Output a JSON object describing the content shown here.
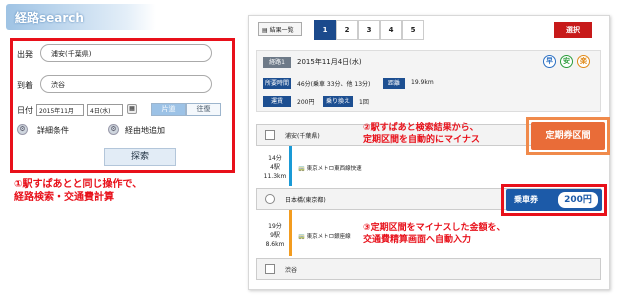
{
  "header": {
    "title": "経路search"
  },
  "form": {
    "departure_label": "出発",
    "departure_value": "浦安(千葉県)",
    "arrival_label": "到着",
    "arrival_value": "渋谷",
    "date_label": "日付",
    "year_month": "2015年11月",
    "day": "4日(水)",
    "oneway_label": "片道",
    "roundtrip_label": "往復",
    "detail_label": "詳細条件",
    "via_label": "経由地追加",
    "search_label": "探索"
  },
  "notes": {
    "note1_line1": "①駅すぱあとと同じ操作で、",
    "note1_line2": "経路検索・交通費計算",
    "note2_line1": "②駅すぱあと検索結果から、",
    "note2_line2": "定期区間を自動的にマイナス",
    "note3_line1": "③定期区間をマイナスした金額を、",
    "note3_line2": "交通費精算画面へ自動入力"
  },
  "results": {
    "list_label": "結果一覧",
    "tabs": [
      "1",
      "2",
      "3",
      "4",
      "5"
    ],
    "select_label": "選択",
    "route_tag": "経路1",
    "route_date": "2015年11月4日(水)",
    "badges": [
      "早",
      "安",
      "楽"
    ],
    "time_tag": "所要時間",
    "time_value": "46分(乗車 33分、他 13分)",
    "dist_tag": "距離",
    "dist_value": "19.9km",
    "fare_tag": "運賃",
    "fare_value": "200円",
    "transfer_tag": "乗り換え",
    "transfer_value": "1回",
    "stations": [
      "浦安(千葉県)",
      "日本橋(東京都)",
      "渋谷"
    ],
    "seg1": {
      "time": "14分",
      "stops": "4駅",
      "dist": "11.3km",
      "line": "東京メトロ東西線快速"
    },
    "seg2": {
      "time": "19分",
      "stops": "9駅",
      "dist": "8.6km",
      "line": "東京メトロ銀座線"
    },
    "teiki_label": "定期券区間",
    "fare_box_label": "乗車券",
    "fare_box_amount": "200円"
  },
  "colors": {
    "accent_red": "#e8101a",
    "nav_blue": "#1b4a8c",
    "teiki_orange": "#e96c38"
  }
}
